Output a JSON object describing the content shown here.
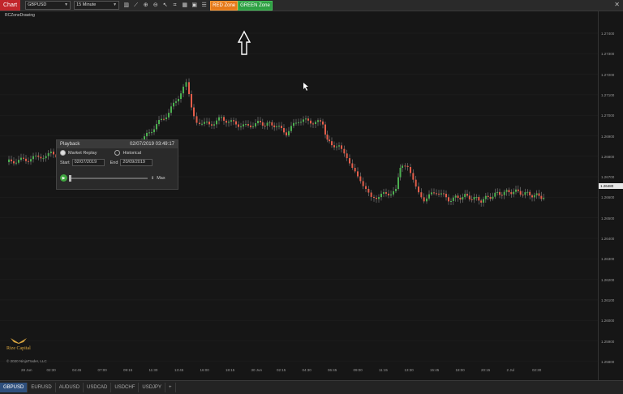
{
  "toolbar": {
    "chart_label": "Chart",
    "instrument": "GBPUSD",
    "interval": "15 Minute",
    "red_zone": "RED Zone",
    "green_zone": "GREEN Zone",
    "close": "✕"
  },
  "indicator_label": "RCZoneDrawing",
  "playback": {
    "title": "Playback",
    "timestamp": "02/07/2019 03:49:17",
    "market_replay": "Market Replay",
    "historical": "Historical",
    "start_label": "Start",
    "start_value": "02/07/2019",
    "end_label": "End",
    "end_value": "20/09/2019",
    "max_label": "Max"
  },
  "price_axis": [
    "1.27400",
    "1.27300",
    "1.27200",
    "1.27100",
    "1.27000",
    "1.26900",
    "1.26800",
    "1.26700",
    "1.26600",
    "1.26500",
    "1.26400",
    "1.26300",
    "1.26200",
    "1.26100",
    "1.26000",
    "1.25900",
    "1.25800"
  ],
  "current_price": "1.26480",
  "time_axis": [
    "28 Jun",
    "02:30",
    "04:45",
    "07:00",
    "09:15",
    "11:30",
    "13:45",
    "16:00",
    "18:15",
    "30 Jun",
    "02:15",
    "04:30",
    "06:45",
    "09:00",
    "11:15",
    "13:30",
    "15:45",
    "18:00",
    "20:15",
    "2 Jul",
    "02:30"
  ],
  "logo_text": "Rize Capital",
  "copyright": "© 2020 NinjaTrader, LLC",
  "bottom_tabs": [
    "GBPUSD",
    "EURUSD",
    "AUDUSD",
    "USDCAD",
    "USDCHF",
    "USDJPY",
    "+"
  ],
  "colors": {
    "up": "#4caf50",
    "down": "#e35d4a",
    "wick": "#9a9a9a"
  }
}
